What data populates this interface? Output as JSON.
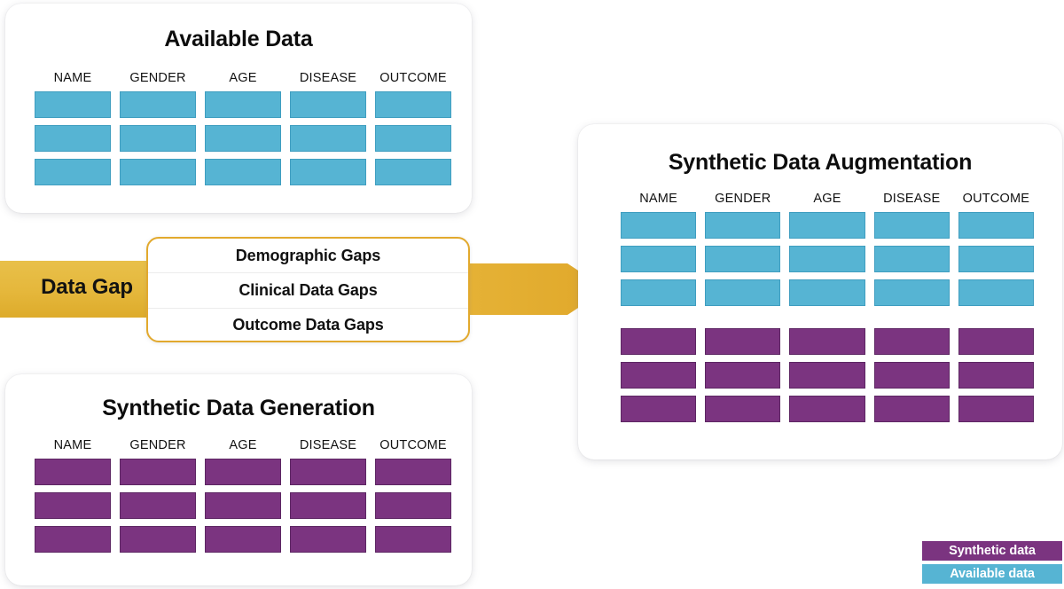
{
  "background_color": "#ffffff",
  "colors": {
    "available_data": "#56b4d3",
    "available_data_border": "#3f9ec0",
    "synthetic_data": "#7b3480",
    "synthetic_data_border": "#5d2663",
    "arrow_gold": "#e5b73b",
    "arrow_gold_dark": "#e0a92c",
    "gap_box_border": "#e2a92d",
    "title_text": "#0d0d0d"
  },
  "panels": {
    "available": {
      "title": "Available Data",
      "columns": [
        "NAME",
        "GENDER",
        "AGE",
        "DISEASE",
        "OUTCOME"
      ],
      "rows": [
        {
          "type": "available"
        },
        {
          "type": "available"
        },
        {
          "type": "available"
        }
      ]
    },
    "generation": {
      "title": "Synthetic Data Generation",
      "columns": [
        "NAME",
        "GENDER",
        "AGE",
        "DISEASE",
        "OUTCOME"
      ],
      "rows": [
        {
          "type": "synthetic"
        },
        {
          "type": "synthetic"
        },
        {
          "type": "synthetic"
        }
      ]
    },
    "augmentation": {
      "title": "Synthetic Data Augmentation",
      "columns": [
        "NAME",
        "GENDER",
        "AGE",
        "DISEASE",
        "OUTCOME"
      ],
      "rows": [
        {
          "type": "available"
        },
        {
          "type": "available"
        },
        {
          "type": "available"
        },
        {
          "type": "synthetic"
        },
        {
          "type": "synthetic"
        },
        {
          "type": "synthetic"
        }
      ]
    }
  },
  "arrow": {
    "label": "Data Gap",
    "gaps": [
      "Demographic Gaps",
      "Clinical Data Gaps",
      "Outcome Data Gaps"
    ]
  },
  "legend": {
    "items": [
      {
        "label": "Synthetic data",
        "type": "synthetic"
      },
      {
        "label": "Available data",
        "type": "available"
      }
    ]
  }
}
